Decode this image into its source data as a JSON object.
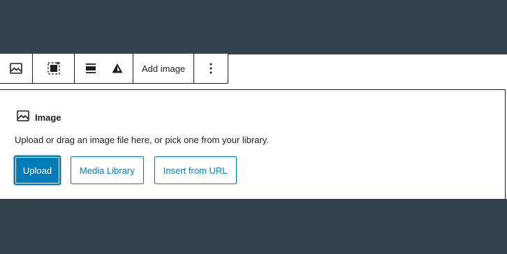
{
  "toolbar": {
    "add_image_label": "Add image",
    "icons": [
      "image-icon",
      "select-parent-icon",
      "align-icon",
      "warning-triangle-icon",
      "more-options-icon"
    ]
  },
  "placeholder": {
    "label": "Image",
    "instructions": "Upload or drag an image file here, or pick one from your library.",
    "buttons": {
      "upload": "Upload",
      "media_library": "Media Library",
      "insert_from_url": "Insert from URL"
    }
  },
  "colors": {
    "background": "#33444f",
    "accent": "#007cba",
    "border": "#1e1e1e"
  }
}
